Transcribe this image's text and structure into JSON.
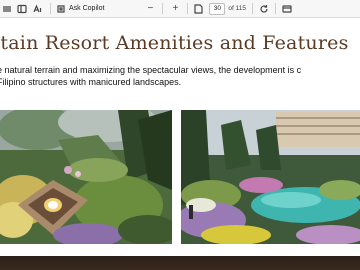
{
  "toolbar": {
    "ask_copilot_label": "Ask Copilot",
    "zoom_out_symbol": "−",
    "zoom_in_symbol": "+",
    "current_page": "30",
    "page_total": "of 115"
  },
  "document": {
    "heading": "ntain Resort Amenities and Features",
    "body_lines": [
      "e natural terrain and maximizing the spectacular views, the development is c",
      "Filipino structures with manicured landscapes."
    ]
  },
  "icons": [
    "sidebar-icon",
    "reading-view-icon",
    "read-aloud-icon",
    "copilot-icon",
    "zoom-out-icon",
    "zoom-in-icon",
    "fit-page-icon",
    "rotate-icon",
    "two-page-icon"
  ]
}
